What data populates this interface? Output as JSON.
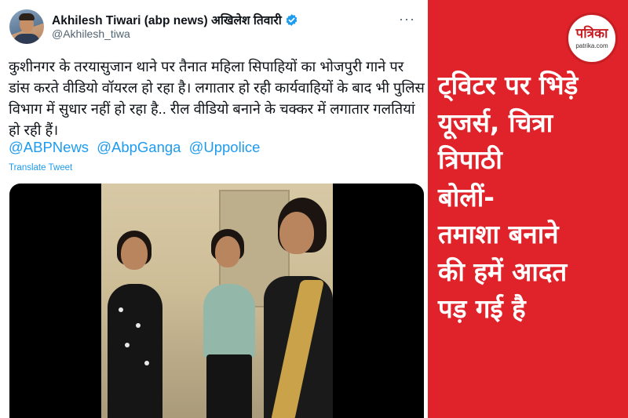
{
  "tweet": {
    "author_name": "Akhilesh Tiwari (abp news) अखिलेश तिवारी",
    "author_handle": "@Akhilesh_tiwa",
    "more_label": "···",
    "text": "कुशीनगर के तरयासुजान थाने पर तैनात महिला सिपाहियों का भोजपुरी गाने पर डांस करते वीडियो वॉयरल हो रहा है। लगातार हो रही कार्यवाहियों के बाद भी पुलिस विभाग में सुधार नहीं हो रहा है.. रील वीडियो बनाने के चक्कर में लगातार गलतियां हो रही हैं।",
    "mentions": [
      "@ABPNews",
      "@AbpGanga",
      "@Uppolice"
    ],
    "translate_label": "Translate Tweet"
  },
  "brand": {
    "logo_text": "पत्रिका",
    "logo_sub": "patrika.com",
    "accent_color": "#e0232a"
  },
  "headline": {
    "lines": [
      "ट्विटर पर भिड़े",
      "यूजर्स, चित्रा",
      "त्रिपाठी",
      "बोलीं-",
      "तमाशा बनाने",
      "की हमें आदत",
      "पड़ गई है"
    ]
  },
  "icons": {
    "verified": "verified-badge-icon",
    "more": "more-options-icon"
  }
}
